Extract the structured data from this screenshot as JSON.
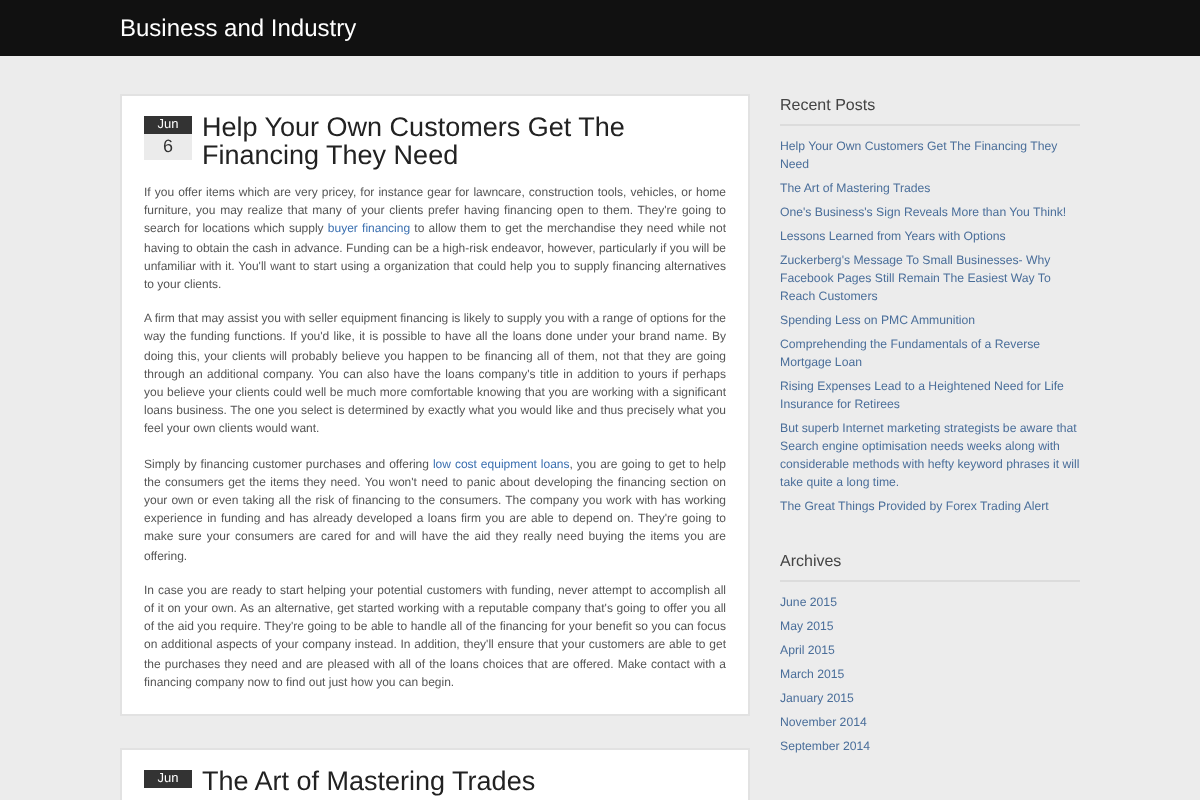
{
  "site": {
    "title": "Business and Industry"
  },
  "posts": [
    {
      "month": "Jun",
      "day": "6",
      "title": "Help Your Own Customers Get The Financing They Need",
      "paragraphs": [
        [
          {
            "kind": "text",
            "text": "If you offer items which are very pricey, for instance gear for lawncare, construction tools, vehicles, or home furniture, you may realize that many of your clients prefer having financing open to them. They're going to search for locations which supply "
          },
          {
            "kind": "link",
            "text": "buyer financing"
          },
          {
            "kind": "text",
            "text": " to allow them to get the merchandise they need while not having to obtain the cash in advance. Funding can be a high-risk endeavor, however, particularly if you will be unfamiliar with it. You'll want to start using a organization that could help you to supply financing alternatives to your clients."
          }
        ],
        [
          {
            "kind": "text",
            "text": "A firm that may assist you with seller equipment financing is likely to supply you with a range of options for the way the funding functions. If you'd like, it is possible to have all the loans done under your brand name. By doing this, your clients will probably believe you happen to be financing all of them, not that they are going through an additional company. You can also have the loans company's title in addition to yours if perhaps you believe your clients could well be much more comfortable knowing that you are working with a significant loans business. The one you select is determined by exactly what you would like and thus precisely what you feel your own clients would want."
          }
        ],
        [
          {
            "kind": "text",
            "text": "Simply by financing customer purchases and offering "
          },
          {
            "kind": "link",
            "text": "low cost equipment loans"
          },
          {
            "kind": "text",
            "text": ", you are going to get to help the consumers get the items they need. You won't need to panic about developing the financing section on your own or even taking all the risk of financing to the consumers. The company you work with has working experience in funding and has already developed a loans firm you are able to depend on. They're going to make sure your consumers are cared for and will have the aid they really need buying the items you are offering."
          }
        ],
        [
          {
            "kind": "text",
            "text": "In case you are ready to start helping your potential customers with funding, never attempt to accomplish all of it on your own. As an alternative, get started working with a reputable company that's going to offer you all of the aid you require. They're going to be able to handle all of the financing for your benefit so you can focus on additional aspects of your company instead. In addition, they'll ensure that your customers are able to get the purchases they need and are pleased with all of the loans choices that are offered. Make contact with a financing company now to find out just how you can begin."
          }
        ]
      ]
    },
    {
      "month": "Jun",
      "title": "The Art of Mastering Trades"
    }
  ],
  "sidebar": [
    {
      "heading": "Recent Posts",
      "links": [
        "Help Your Own Customers Get The Financing They Need",
        "The Art of Mastering Trades",
        "One's Business's Sign Reveals More than You Think!",
        "Lessons Learned from Years with Options",
        "Zuckerberg's Message To Small Businesses- Why Facebook Pages Still Remain The Easiest Way To Reach Customers",
        "Spending Less on PMC Ammunition",
        "Comprehending the Fundamentals of a Reverse Mortgage Loan",
        "Rising Expenses Lead to a Heightened Need for Life Insurance for Retirees",
        "But superb Internet marketing strategists be aware that Search engine optimisation needs weeks along with considerable methods with hefty keyword phrases it will take quite a long time.",
        "The Great Things Provided by Forex Trading Alert"
      ]
    },
    {
      "heading": "Archives",
      "links": [
        "June 2015",
        "May 2015",
        "April 2015",
        "March 2015",
        "January 2015",
        "November 2014",
        "September 2014"
      ]
    }
  ]
}
